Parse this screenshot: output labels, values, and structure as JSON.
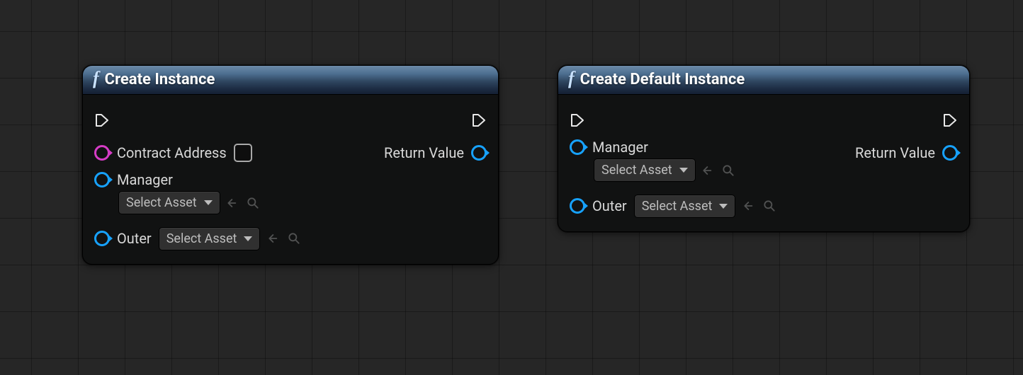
{
  "nodes": [
    {
      "title": "Create Instance",
      "inputs": {
        "contract_address": {
          "label": "Contract Address",
          "value": ""
        },
        "manager": {
          "label": "Manager",
          "asset_select": "Select Asset"
        },
        "outer": {
          "label": "Outer",
          "asset_select": "Select Asset"
        }
      },
      "outputs": {
        "return_value": {
          "label": "Return Value"
        }
      }
    },
    {
      "title": "Create Default Instance",
      "inputs": {
        "manager": {
          "label": "Manager",
          "asset_select": "Select Asset"
        },
        "outer": {
          "label": "Outer",
          "asset_select": "Select Asset"
        }
      },
      "outputs": {
        "return_value": {
          "label": "Return Value"
        }
      }
    }
  ],
  "colors": {
    "string_pin": "#d63cc6",
    "object_pin": "#17a2ff"
  }
}
